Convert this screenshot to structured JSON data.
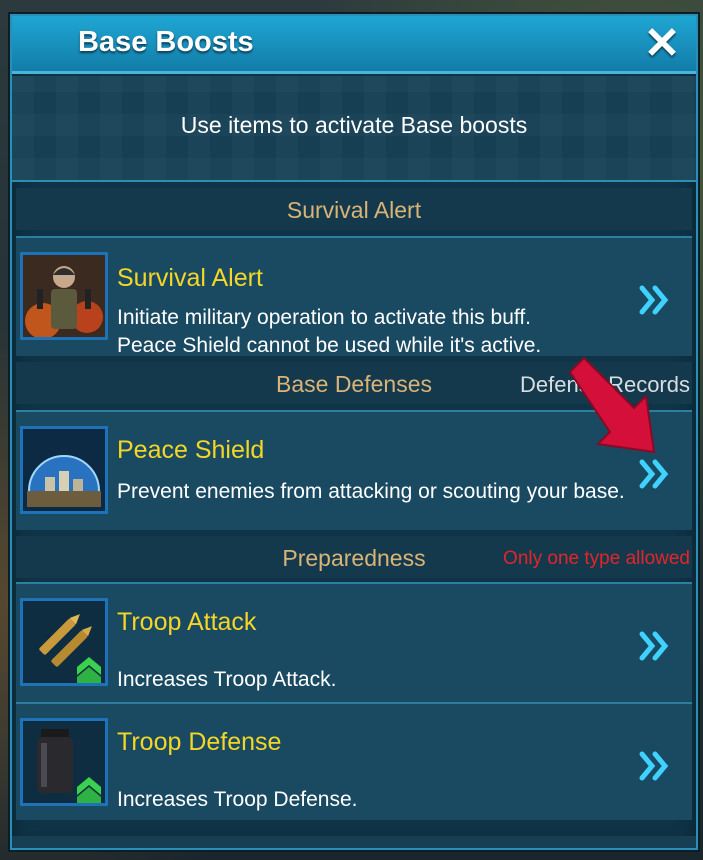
{
  "header": {
    "title": "Base Boosts",
    "close_icon": "close-icon"
  },
  "subtitle": "Use items to activate Base boosts",
  "sections": [
    {
      "label": "Survival Alert",
      "aside": "",
      "items": [
        {
          "title": "Survival Alert",
          "desc": "Initiate military operation to activate this buff.\nPeace Shield cannot be used while it's active.",
          "icon": "soldier-portrait-icon"
        }
      ]
    },
    {
      "label": "Base Defenses",
      "aside": "Defense Records",
      "aside_color": "#d8dde0",
      "items": [
        {
          "title": "Peace Shield",
          "desc": "Prevent enemies from attacking or scouting your base.",
          "icon": "shield-dome-icon"
        }
      ]
    },
    {
      "label": "Preparedness",
      "aside": "Only one type allowed",
      "aside_color": "#e0262b",
      "items": [
        {
          "title": "Troop Attack",
          "desc": "Increases Troop Attack.",
          "icon": "bullets-icon"
        },
        {
          "title": "Troop Defense",
          "desc": "Increases Troop Defense.",
          "icon": "armor-vest-icon"
        }
      ]
    }
  ],
  "colors": {
    "title": "#ffffff",
    "item_title": "#f4d626",
    "section_label": "#d9b478",
    "chevron": "#3fd2ff",
    "pointer_arrow": "#d4103a"
  }
}
